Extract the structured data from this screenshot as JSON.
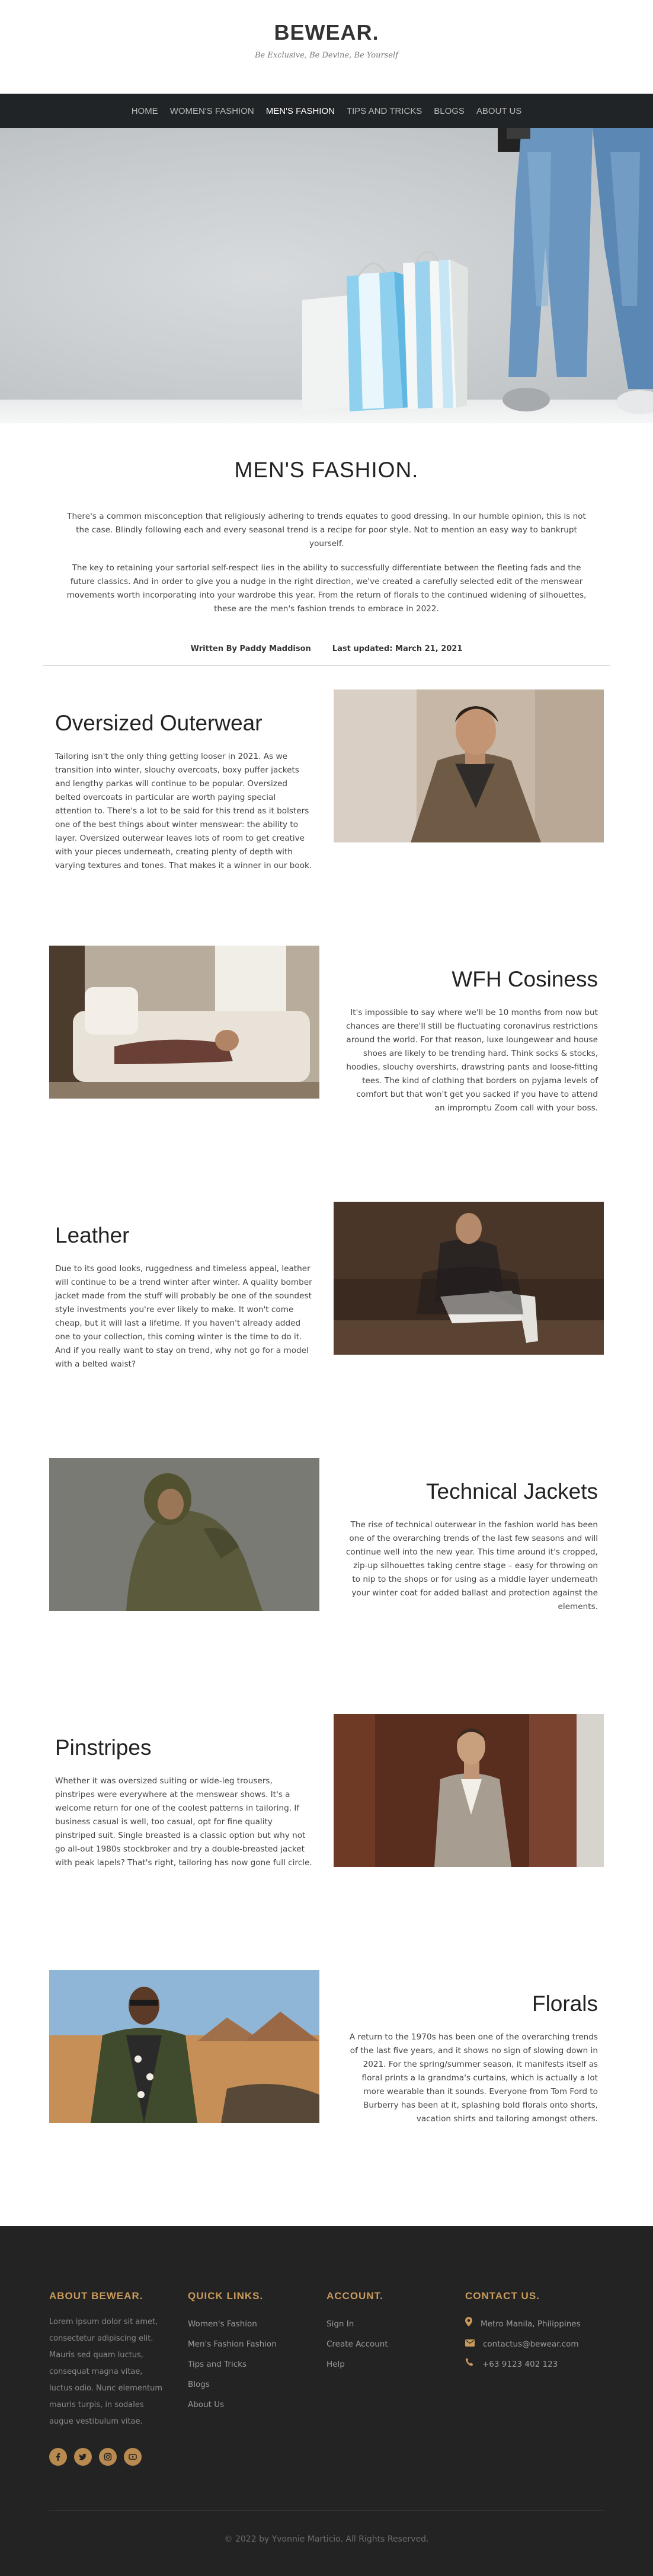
{
  "header": {
    "brand": "BEWEAR.",
    "tagline": "Be Exclusive, Be Devine, Be Yourself"
  },
  "nav": {
    "items": [
      {
        "label": "HOME"
      },
      {
        "label": "WOMEN'S FASHION"
      },
      {
        "label": "MEN'S FASHION"
      },
      {
        "label": "TIPS AND TRICKS"
      },
      {
        "label": "BLOGS"
      },
      {
        "label": "ABOUT US"
      }
    ],
    "active": "MEN'S FASHION"
  },
  "intro": {
    "title": "MEN'S FASHION.",
    "paragraph1": "There's a common misconception that religiously adhering to trends equates to good dressing. In our humble opinion, this is not the case. Blindly following each and every seasonal trend is a recipe for poor style. Not to mention an easy way to bankrupt yourself.",
    "paragraph2": "The key to retaining your sartorial self-respect lies in the ability to successfully differentiate between the fleeting fads and the future classics. And in order to give you a nudge in the right direction, we've created a carefully selected edit of the menswear movements worth incorporating into your wardrobe this year. From the return of florals to the continued widening of silhouettes, these are the men's fashion trends to embrace in 2022.",
    "author": "Written By Paddy Maddison",
    "updated": "Last updated: March 21, 2021"
  },
  "articles": [
    {
      "title": "Oversized Outerwear",
      "body": "Tailoring isn't the only thing getting looser in 2021. As we transition into winter, slouchy overcoats, boxy puffer jackets and lengthy parkas will continue to be popular. Oversized belted overcoats in particular are worth paying special attention to. There's a lot to be said for this trend as it bolsters one of the best things about winter menswear: the ability to layer. Oversized outerwear leaves lots of room to get creative with your pieces underneath, creating plenty of depth with varying textures and tones. That makes it a winner in our book."
    },
    {
      "title": "WFH Cosiness",
      "body": "It's impossible to say where we'll be 10 months from now but chances are there'll still be fluctuating coronavirus restrictions around the world. For that reason, luxe loungewear and house shoes are likely to be trending hard. Think socks & stocks, hoodies, slouchy overshirts, drawstring pants and loose-fitting tees. The kind of clothing that borders on pyjama levels of comfort but that won't get you sacked if you have to attend an impromptu Zoom call with your boss."
    },
    {
      "title": "Leather",
      "body": "Due to its good looks, ruggedness and timeless appeal, leather will continue to be a trend winter after winter. A quality bomber jacket made from the stuff will probably be one of the soundest style investments you're ever likely to make. It won't come cheap, but it will last a lifetime. If you haven't already added one to your collection, this coming winter is the time to do it. And if you really want to stay on trend, why not go for a model with a belted waist?"
    },
    {
      "title": "Technical Jackets",
      "body": "The rise of technical outerwear in the fashion world has been one of the overarching trends of the last few seasons and will continue well into the new year. This time around it's cropped, zip-up silhouettes taking centre stage – easy for throwing on to nip to the shops or for using as a middle layer underneath your winter coat for added ballast and protection against the elements."
    },
    {
      "title": "Pinstripes",
      "body": "Whether it was oversized suiting or wide-leg trousers, pinstripes were everywhere at the menswear shows. It's a welcome return for one of the coolest patterns in tailoring. If business casual is well, too casual, opt for fine quality pinstriped suit. Single breasted is a classic option but why not go all-out 1980s stockbroker and try a double-breasted jacket with peak lapels? That's right, tailoring has now gone full circle."
    },
    {
      "title": "Florals",
      "body": "A return to the 1970s has been one of the overarching trends of the last five years, and it shows no sign of slowing down in 2021. For the spring/summer season, it manifests itself as floral prints a la grandma's curtains, which is actually a lot more wearable than it sounds. Everyone from Tom Ford to Burberry has been at it, splashing bold florals onto shorts, vacation shirts and tailoring amongst others."
    }
  ],
  "footer": {
    "about_heading": "ABOUT BEWEAR.",
    "about_text": "Lorem ipsum dolor sit amet, consectetur adipiscing elit. Mauris sed quam luctus, consequat magna vitae, luctus odio. Nunc elementum mauris turpis, in sodales augue vestibulum vitae.",
    "quick_heading": "QUICK LINKS.",
    "quick_links": [
      "Women's Fashion",
      "Men's Fashion Fashion",
      "Tips and Tricks",
      "Blogs",
      "About Us"
    ],
    "account_heading": "ACCOUNT.",
    "account_links": [
      "Sign In",
      "Create Account",
      "Help"
    ],
    "contact_heading": "CONTACT US.",
    "contact": {
      "location": "Metro Manila, Philippines",
      "email": "contactus@bewear.com",
      "phone": "+63 9123 402 123"
    },
    "socials": [
      "facebook-icon",
      "twitter-icon",
      "instagram-icon",
      "youtube-icon"
    ],
    "copyright": "© 2022 by Yvonnie Marticio. All Rights Reserved."
  },
  "colors": {
    "nav_bg": "#212426",
    "footer_bg": "#232323",
    "accent": "#c99a5a"
  }
}
